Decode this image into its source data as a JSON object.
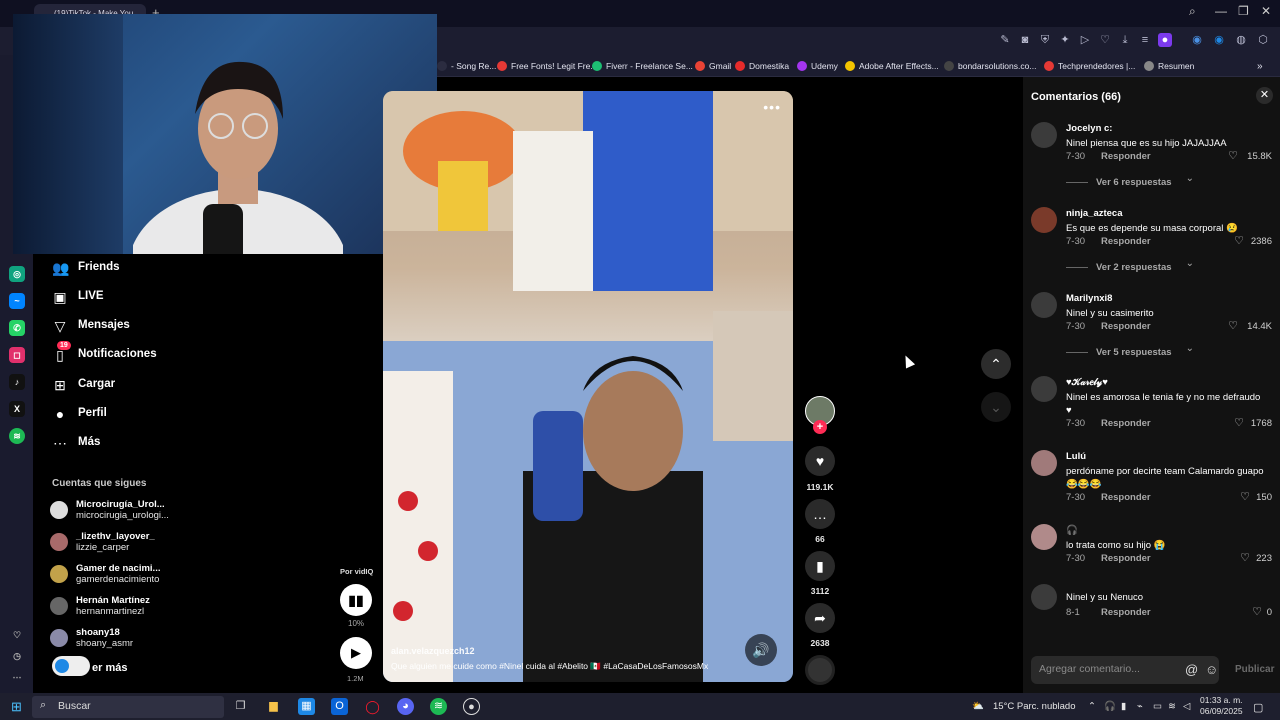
{
  "browser": {
    "tab_title": "(19)TikTok - Make You",
    "bookmarks": [
      {
        "label": "- Song Re...",
        "color": "#2b2c40"
      },
      {
        "label": "Free Fonts! Legit Fre...",
        "color": "#e53935"
      },
      {
        "label": "Fiverr - Freelance Se...",
        "color": "#1dbf73"
      },
      {
        "label": "Gmail",
        "color": "#ea4335"
      },
      {
        "label": "Domestika",
        "color": "#e62b2b"
      },
      {
        "label": "Udemy",
        "color": "#a435f0"
      },
      {
        "label": "Adobe After Effects...",
        "color": "#f4c400"
      },
      {
        "label": "bondarsolutions.co...",
        "color": "#444"
      },
      {
        "label": "Techprendedores |...",
        "color": "#e53935"
      },
      {
        "label": "Resumen",
        "color": "#888"
      }
    ]
  },
  "sidebar": {
    "nav": [
      {
        "label": "Friends",
        "icon": "friends-icon"
      },
      {
        "label": "LIVE",
        "icon": "live-icon"
      },
      {
        "label": "Mensajes",
        "icon": "messages-icon"
      },
      {
        "label": "Notificaciones",
        "icon": "notifications-icon",
        "badge": "19"
      },
      {
        "label": "Cargar",
        "icon": "upload-icon"
      },
      {
        "label": "Perfil",
        "icon": "profile-icon"
      },
      {
        "label": "Más",
        "icon": "more-icon"
      }
    ],
    "following_title": "Cuentas que sigues",
    "accounts": [
      {
        "name": "Microcirugía_Urol...",
        "handle": "microcirugia_urologi..."
      },
      {
        "name": "_lizethv_layover_",
        "handle": "lizzie_carper"
      },
      {
        "name": "Gamer de nacimi...",
        "handle": "gamerdenacimiento"
      },
      {
        "name": "Hernán Martínez",
        "handle": "hernanmartinezl"
      },
      {
        "name": "shoany18",
        "handle": "shoany_asmr"
      }
    ],
    "see_more": "er más"
  },
  "video": {
    "author": "alan.velazquezch12",
    "caption": "Que alguien me cuide como #Ninel  cuida al #Abelito  🇲🇽  #LaCasaDeLosFamososMx",
    "likes": "119.1K",
    "comments": "66",
    "saves": "3112",
    "shares": "2638"
  },
  "vidiq": {
    "label": "Por vidIQ",
    "percent": "10%",
    "views": "1.2M"
  },
  "comments": {
    "title": "Comentarios (66)",
    "items": [
      {
        "user": "Jocelyn c:",
        "text": "Ninel piensa que es su hijo JAJAJJAA",
        "date": "7-30",
        "reply": "Responder",
        "likes": "15.8K",
        "more": "Ver 6 respuestas"
      },
      {
        "user": "ninja_azteca",
        "text": "Es que es depende su masa corporal 😢",
        "date": "7-30",
        "reply": "Responder",
        "likes": "2386",
        "more": "Ver 2 respuestas"
      },
      {
        "user": "Marilynxi8",
        "text": "Ninel y su casimerito",
        "date": "7-30",
        "reply": "Responder",
        "likes": "14.4K",
        "more": "Ver 5 respuestas"
      },
      {
        "user": "♥𝒦𝒶𝓇𝑒𝓁𝓎♥",
        "text": "Ninel es amorosa le tenia fe y no me defraudo ♥",
        "date": "7-30",
        "reply": "Responder",
        "likes": "1768",
        "more": ""
      },
      {
        "user": "Lulú",
        "text": "perdóname por decirte team Calamardo guapo 😂😂😂",
        "date": "7-30",
        "reply": "Responder",
        "likes": "150",
        "more": ""
      },
      {
        "user": "🎧",
        "text": "lo trata como su hijo 😭",
        "date": "7-30",
        "reply": "Responder",
        "likes": "223",
        "more": ""
      },
      {
        "user": "",
        "text": "Ninel y su Nenuco",
        "date": "8-1",
        "reply": "Responder",
        "likes": "0",
        "more": ""
      }
    ],
    "input_placeholder": "Agregar comentario...",
    "post_label": "Publicar"
  },
  "taskbar": {
    "search_label": "Buscar",
    "weather": "15°C  Parc. nublado",
    "time": "01:33 a. m.",
    "date": "06/09/2025"
  }
}
